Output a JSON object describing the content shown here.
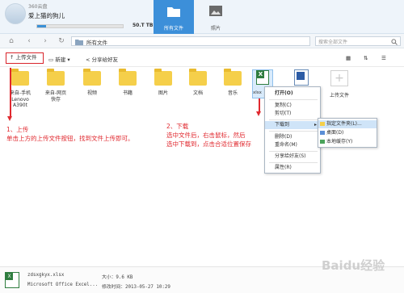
{
  "header": {
    "app_name": "360云盘",
    "user_name": "爱上猫的狗儿",
    "quota_text": "50.T TB",
    "quota_progress": 0.1,
    "tabs": [
      {
        "label": "所有文件",
        "active": true
      },
      {
        "label": "照片",
        "active": false
      }
    ]
  },
  "nav": {
    "path": "所有文件",
    "search_placeholder": "搜索全部文件"
  },
  "toolbar": {
    "upload": "上传文件",
    "new": "新建",
    "share": "分享给好友"
  },
  "files": [
    {
      "name": "来自-手机Lenovo A390t"
    },
    {
      "name": "来自-网页快存"
    },
    {
      "name": "视频"
    },
    {
      "name": "书籍"
    },
    {
      "name": "图片"
    },
    {
      "name": "文档"
    },
    {
      "name": "音乐"
    },
    {
      "name": "xlsx"
    },
    {
      "name": "上传文件"
    }
  ],
  "context_menu": {
    "items": [
      "打开(O)",
      "复制(C)",
      "剪切(T)",
      "下载到",
      "删除(D)",
      "重命名(M)",
      "分享给好友(S)",
      "属性(R)"
    ],
    "submenu": [
      "指定文件夹(L)...",
      "桌面(D)",
      "本地缓存(Y)"
    ]
  },
  "annotations": {
    "step1_title": "1、上传",
    "step1_text": "单击上方的上传文件按钮，找到文件上传即可。",
    "step2_title": "2、下载",
    "step2_line1": "选中文件后，右击鼠标，然后",
    "step2_line2": "选中下载到，点击合适位置保存"
  },
  "status": {
    "file_name": "zdsxgkyx.xlsx",
    "file_type": "Microsoft Office Excel...",
    "size": "大小：9.6 KB",
    "modified": "修改时间：2013-05-27 10:29"
  },
  "watermark": "Baidu经验",
  "colors": {
    "accent_blue": "#3c8fd9",
    "annotation_red": "#e0292f",
    "folder_yellow": "#f5cf4a",
    "excel_green": "#2f7d3f"
  }
}
